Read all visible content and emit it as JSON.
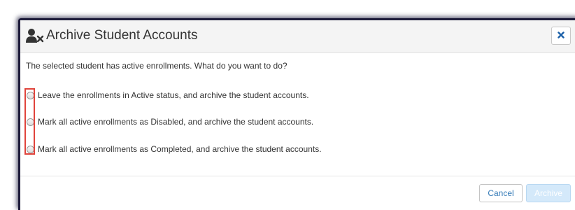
{
  "dialog": {
    "title": "Archive Student Accounts",
    "title_icon": "user-times-icon",
    "close_icon": "close-icon",
    "message": "The selected student has active enrollments. What do you want to do?",
    "options": [
      {
        "label": "Leave the enrollments in Active status, and archive the student accounts.",
        "selected": false
      },
      {
        "label": "Mark all active enrollments as Disabled, and archive the student accounts.",
        "selected": false
      },
      {
        "label": "Mark all active enrollments as Completed, and archive the student accounts.",
        "selected": false
      }
    ],
    "buttons": {
      "cancel": "Cancel",
      "archive": "Archive",
      "archive_enabled": false
    }
  },
  "colors": {
    "link_blue": "#337ab7",
    "highlight_red": "#e0443c",
    "disabled_button": "#d4e9fa"
  }
}
